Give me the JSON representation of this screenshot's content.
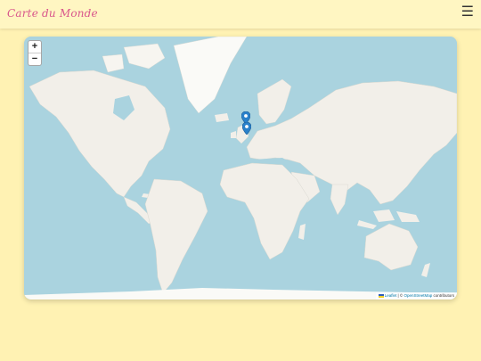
{
  "header": {
    "title": "Carte du Monde",
    "menu_icon": "☰"
  },
  "map": {
    "zoom_in_label": "+",
    "zoom_out_label": "−",
    "attribution": {
      "leaflet_label": "Leaflet",
      "separator": " | © ",
      "osm_label": "OpenStreetMap",
      "contributors_label": " contributors"
    },
    "markers": [
      {
        "name": "marker-uk"
      },
      {
        "name": "marker-france"
      }
    ],
    "colors": {
      "ocean": "#aad3df",
      "land": "#f2efe9",
      "ice": "#fafaf7",
      "marker": "#2a81cb"
    }
  }
}
